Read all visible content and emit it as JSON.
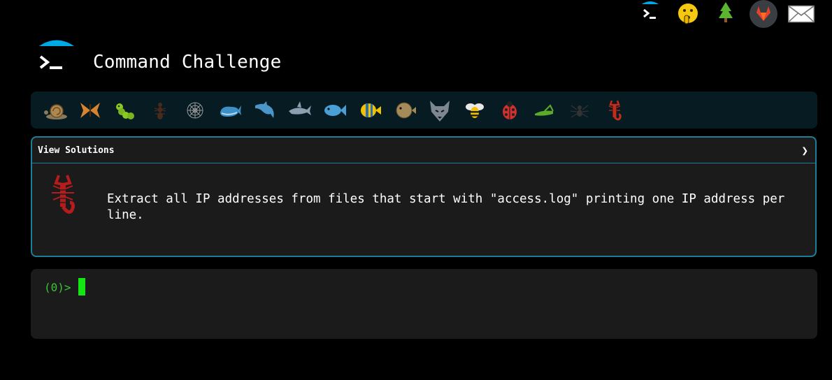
{
  "header": {
    "title": "Command Challenge"
  },
  "top_icons": [
    "terminal-icon",
    "shushing-face-icon",
    "tree-icon",
    "gitlab-icon",
    "mail-icon"
  ],
  "creatures": [
    "snail",
    "butterfly",
    "caterpillar",
    "ant",
    "spider-web",
    "whale",
    "dolphin",
    "shark",
    "fish",
    "tropical-fish",
    "blowfish",
    "wolf",
    "bee",
    "ladybug",
    "cricket",
    "spider",
    "scorpion"
  ],
  "solutions": {
    "label": "View Solutions",
    "chevron": "❯",
    "challenge": "Extract all IP addresses from files that start with \"access.log\" printing one IP address per line."
  },
  "terminal": {
    "prompt": "(0)>"
  },
  "colors": {
    "accent": "#1c7e98",
    "bar_bg": "#061b22",
    "panel_bg": "#1b1b1b",
    "prompt": "#3bc33b",
    "cursor": "#14e614",
    "logo_cap": "#00a8e8"
  }
}
